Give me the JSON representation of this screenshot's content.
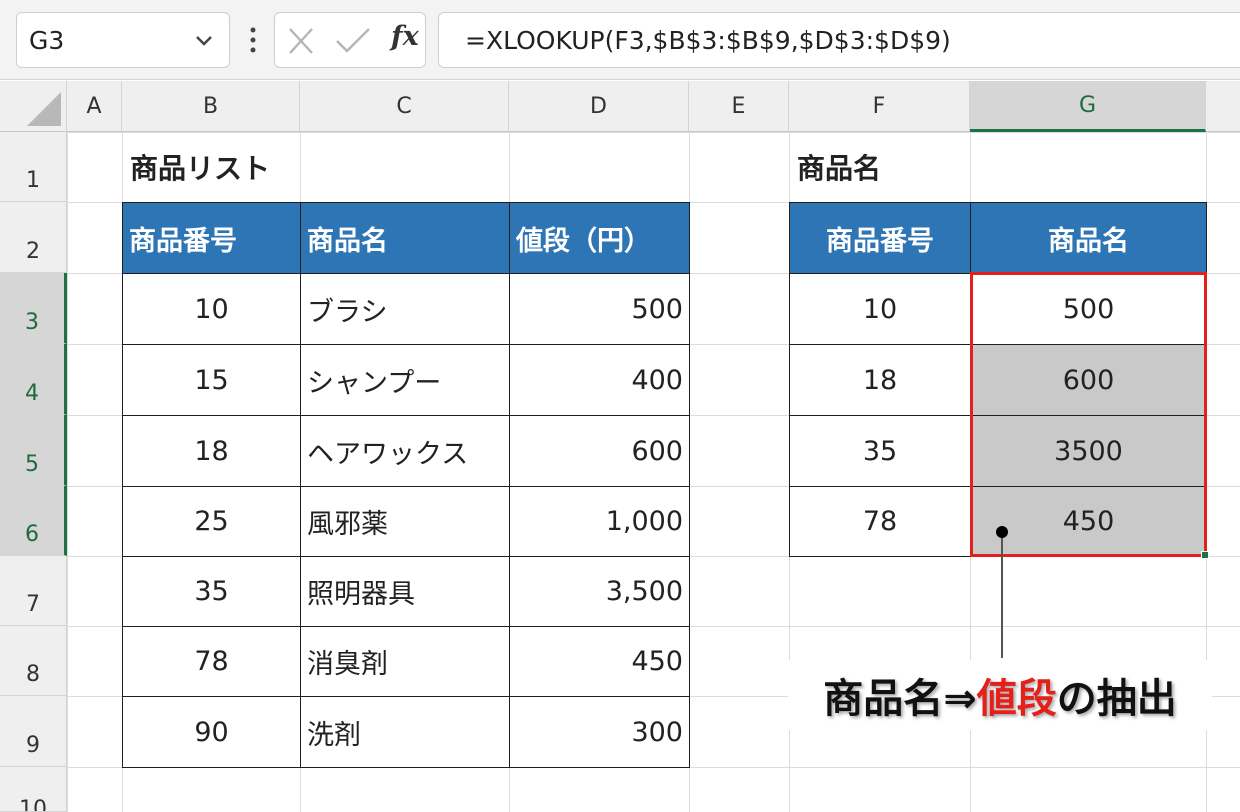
{
  "formula_bar": {
    "name_box": "G3",
    "cancel_icon": "close-icon",
    "enter_icon": "check-icon",
    "fx_label": "fx",
    "formula": "=XLOOKUP(F3,$B$3:$B$9,$D$3:$D$9)"
  },
  "grid": {
    "columns": [
      "A",
      "B",
      "C",
      "D",
      "E",
      "F",
      "G"
    ],
    "selected_column": "G",
    "rows": [
      "1",
      "2",
      "3",
      "4",
      "5",
      "6",
      "7",
      "8",
      "9",
      "10"
    ],
    "selected_rows": [
      "3",
      "4",
      "5",
      "6"
    ]
  },
  "product_list": {
    "title": "商品リスト",
    "headers": [
      "商品番号",
      "商品名",
      "値段（円）"
    ],
    "rows": [
      {
        "id": "10",
        "name": "ブラシ",
        "price": "500"
      },
      {
        "id": "15",
        "name": "シャンプー",
        "price": "400"
      },
      {
        "id": "18",
        "name": "ヘアワックス",
        "price": "600"
      },
      {
        "id": "25",
        "name": "風邪薬",
        "price": "1,000"
      },
      {
        "id": "35",
        "name": "照明器具",
        "price": "3,500"
      },
      {
        "id": "78",
        "name": "消臭剤",
        "price": "450"
      },
      {
        "id": "90",
        "name": "洗剤",
        "price": "300"
      }
    ]
  },
  "lookup_table": {
    "title": "商品名",
    "headers": [
      "商品番号",
      "商品名"
    ],
    "rows": [
      {
        "id": "10",
        "result": "500"
      },
      {
        "id": "18",
        "result": "600"
      },
      {
        "id": "35",
        "result": "3500"
      },
      {
        "id": "78",
        "result": "450"
      }
    ]
  },
  "annotation": {
    "part1": "商品名⇒",
    "highlight": "値段",
    "part2": "の抽出"
  },
  "colors": {
    "header_fill": "#2e75b6",
    "selection_border": "#e3201b",
    "selected_fill": "#c9c9c9",
    "excel_green": "#1e7145"
  }
}
